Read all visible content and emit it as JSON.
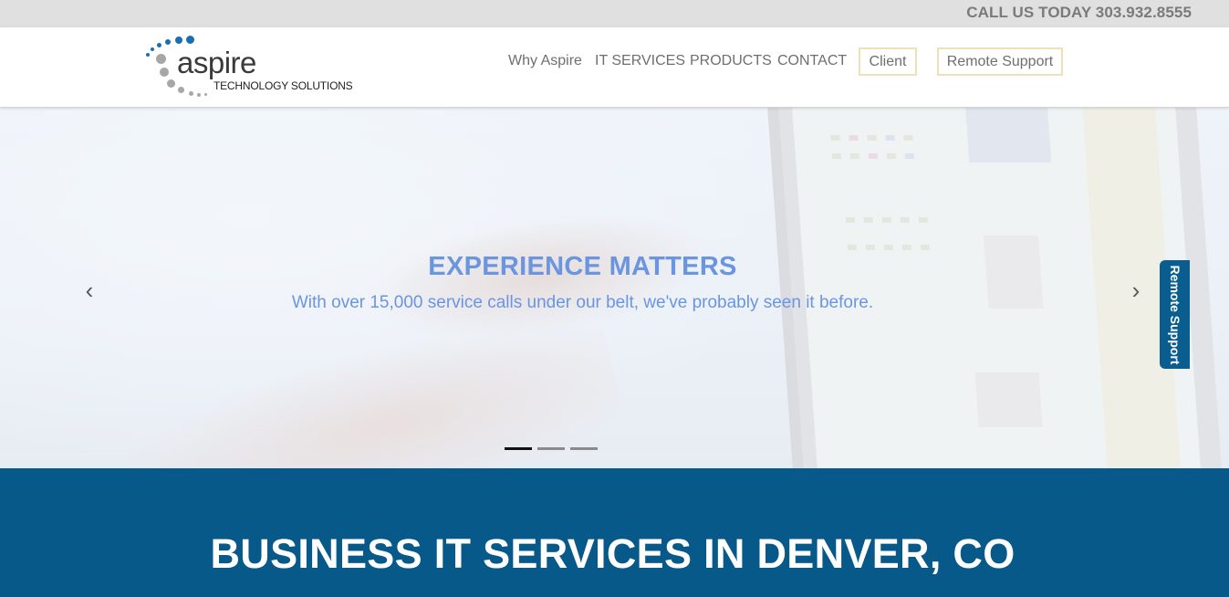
{
  "topbar": {
    "call_text": "CALL US TODAY 303.932.8555"
  },
  "logo": {
    "name": "aspire",
    "tagline": "TECHNOLOGY SOLUTIONS"
  },
  "nav": {
    "items": [
      {
        "label": "Why Aspire"
      },
      {
        "label": "IT SERVICES"
      },
      {
        "label": "PRODUCTS"
      },
      {
        "label": "CONTACT"
      }
    ],
    "buttons": [
      {
        "label": "Client"
      },
      {
        "label": "Remote Support"
      }
    ]
  },
  "hero": {
    "title": "EXPERIENCE MATTERS",
    "subtitle": "With over 15,000 service calls under our belt, we've probably seen it before.",
    "prev_icon": "chevron-left-icon",
    "next_icon": "chevron-right-icon",
    "prev_glyph": "‹",
    "next_glyph": "›",
    "slides_total": 3,
    "slide_active": 1
  },
  "side_tab": {
    "label": "Remote Support"
  },
  "band": {
    "heading": "BUSINESS IT SERVICES IN DENVER, CO"
  },
  "colors": {
    "accent_blue": "#07598a",
    "hero_text": "#6a95e0",
    "logo_blue": "#1a6fb4",
    "logo_gray": "#a7a7a7",
    "button_border": "#f0e0b8"
  }
}
